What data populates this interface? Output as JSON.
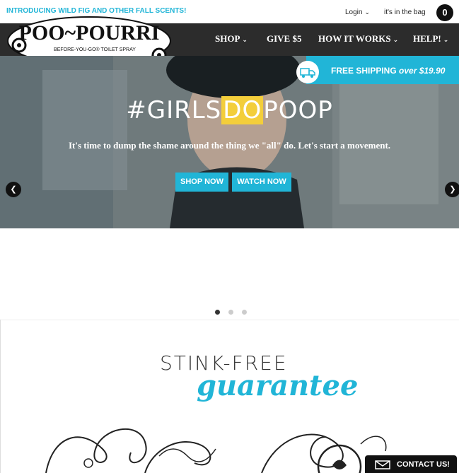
{
  "topbar": {
    "announcement": "INTRODUCING WILD FIG AND OTHER FALL SCENTS!",
    "login": "Login",
    "bag_text": "it's in the bag",
    "bag_count": "0"
  },
  "logo": {
    "name": "POO~POURRI",
    "tagline": "BEFORE-YOU-GO® TOILET SPRAY"
  },
  "nav": {
    "items": [
      {
        "label": "SHOP"
      },
      {
        "label": "GIVE $5"
      },
      {
        "label": "HOW IT WORKS"
      },
      {
        "label": "HELP!"
      }
    ]
  },
  "promo": {
    "free_shipping": "FREE SHIPPING",
    "threshold": "over $19.90"
  },
  "hero": {
    "headline_a": "#GIRLS",
    "headline_b": "DO",
    "headline_c": "POOP",
    "subhead": "It's time to dump the shame around the thing we \"all\" do. Let's start a movement.",
    "shop_now": "SHOP NOW",
    "watch_now": "WATCH NOW"
  },
  "carousel": {
    "active_slide": 1,
    "slide_count": 3
  },
  "guarantee": {
    "line1": "STINK-FREE",
    "line2": "guarantee"
  },
  "contact": {
    "label": "CONTACT US!"
  },
  "colors": {
    "accent": "#21b5d7",
    "dark": "#2c2c2c",
    "highlight": "#f3ce3b"
  }
}
